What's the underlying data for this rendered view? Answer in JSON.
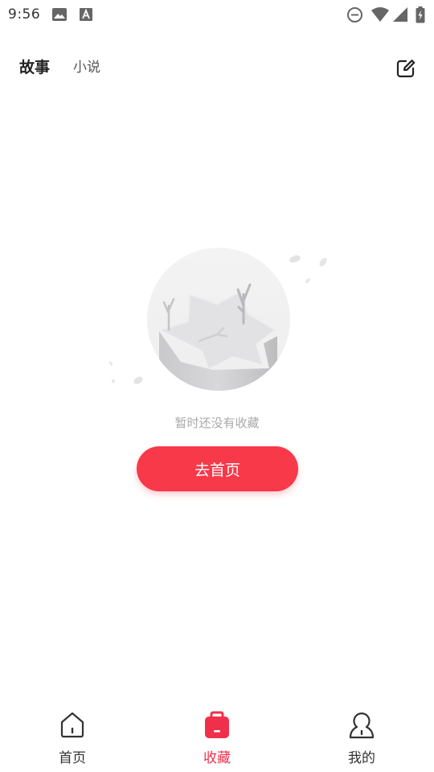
{
  "status_bar": {
    "time": "9:56",
    "icons": [
      "image-icon",
      "font-icon",
      "dnd-icon",
      "wifi-icon",
      "signal-icon",
      "battery-icon"
    ]
  },
  "header": {
    "tabs": [
      {
        "label": "故事",
        "active": true
      },
      {
        "label": "小说",
        "active": false
      }
    ],
    "edit_icon": "edit-icon"
  },
  "empty_state": {
    "illustration": "empty-star-island-illustration",
    "message": "暂时还没有收藏",
    "button_label": "去首页"
  },
  "bottom_nav": {
    "items": [
      {
        "label": "首页",
        "icon": "home-icon",
        "active": false
      },
      {
        "label": "收藏",
        "icon": "bookmark-bag-icon",
        "active": true
      },
      {
        "label": "我的",
        "icon": "user-icon",
        "active": false
      }
    ]
  },
  "colors": {
    "accent": "#f7394a",
    "nav_active": "#f0304b",
    "text_muted": "#a9a9a9"
  }
}
